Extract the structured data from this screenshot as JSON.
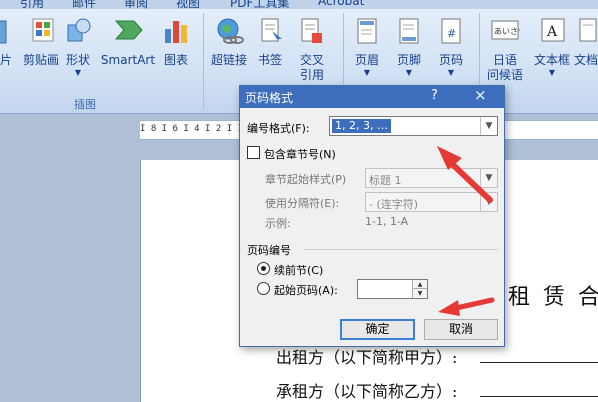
{
  "ribbon": {
    "tabs": [
      "引用",
      "邮件",
      "审阅",
      "视图",
      "PDF工具集",
      "Acrobat"
    ],
    "buttons": {
      "partial_left": "片",
      "clipart": "剪贴画",
      "shapes": "形状",
      "smartart": "SmartArt",
      "chart": "图表",
      "hyperlink": "超链接",
      "bookmark": "书签",
      "crossref_line1": "交叉",
      "crossref_line2": "引用",
      "header": "页眉",
      "footer": "页脚",
      "pagenum": "页码",
      "phonetic_line1": "日语",
      "phonetic_line2": "问候语",
      "textbox": "文本框",
      "partial_right": "文档"
    },
    "groups": {
      "illustrations": "插图"
    }
  },
  "ruler": {
    "numbers": "I 8 I  6 I  4 I  2 I  I  2 I  4 I  6 I  8 I 10 I 12 I 14 I 16 I 18 I 20"
  },
  "document": {
    "heading_fragment": "租 赁 合",
    "lessor_line": "出租方（以下简称甲方）:",
    "lessee_line": "承租方（以下简称乙方）:"
  },
  "dialog": {
    "title": "页码格式",
    "help": "?",
    "close": "×",
    "number_format_label": "编号格式(F):",
    "number_format_value": "1, 2, 3, …",
    "include_chapter_label": "包含章节号(N)",
    "chapter_style_label": "章节起始样式(P)",
    "chapter_style_value": "标题 1",
    "separator_label": "使用分隔符(E):",
    "separator_value": "-  (连字符)",
    "example_label": "示例:",
    "example_value": "1-1, 1-A",
    "page_numbering_label": "页码编号",
    "continue_label": "续前节(C)",
    "start_at_label": "起始页码(A):",
    "start_at_value": "",
    "ok_label": "确定",
    "cancel_label": "取消"
  },
  "colors": {
    "annotation_arrow": "#e53935",
    "dialog_titlebar": "#3c6ebd",
    "ribbon_text": "#15428b"
  }
}
